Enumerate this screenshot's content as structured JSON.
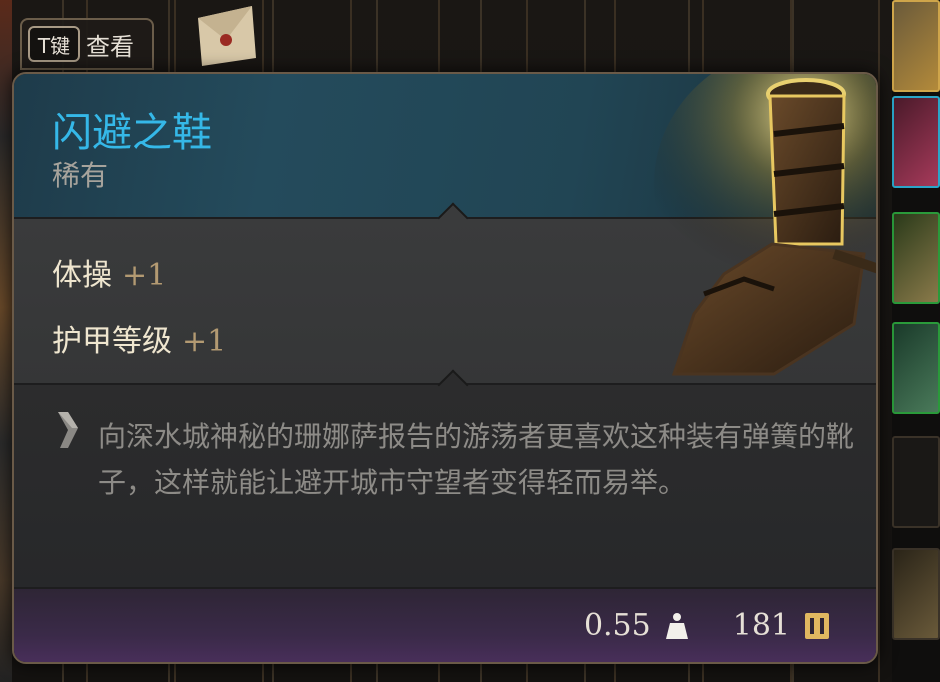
{
  "key_hint": {
    "key": "T键",
    "label": "查看"
  },
  "item": {
    "name": "闪避之鞋",
    "rarity": "稀有",
    "rarity_color": "#35b8e8",
    "stats": [
      {
        "name": "体操",
        "value": "+1"
      },
      {
        "name": "护甲等级",
        "value": "+1"
      }
    ],
    "description": "向深水城神秘的珊娜萨报告的游荡者更喜欢这种装有弹簧的靴子，这样就能让避开城市守望者变得轻而易举。",
    "weight": "0.55",
    "price": "181"
  },
  "icons": {
    "weight": "weight-icon",
    "price": "gold-icon",
    "quote": "quote-mark-icon",
    "item": "boots-icon"
  }
}
